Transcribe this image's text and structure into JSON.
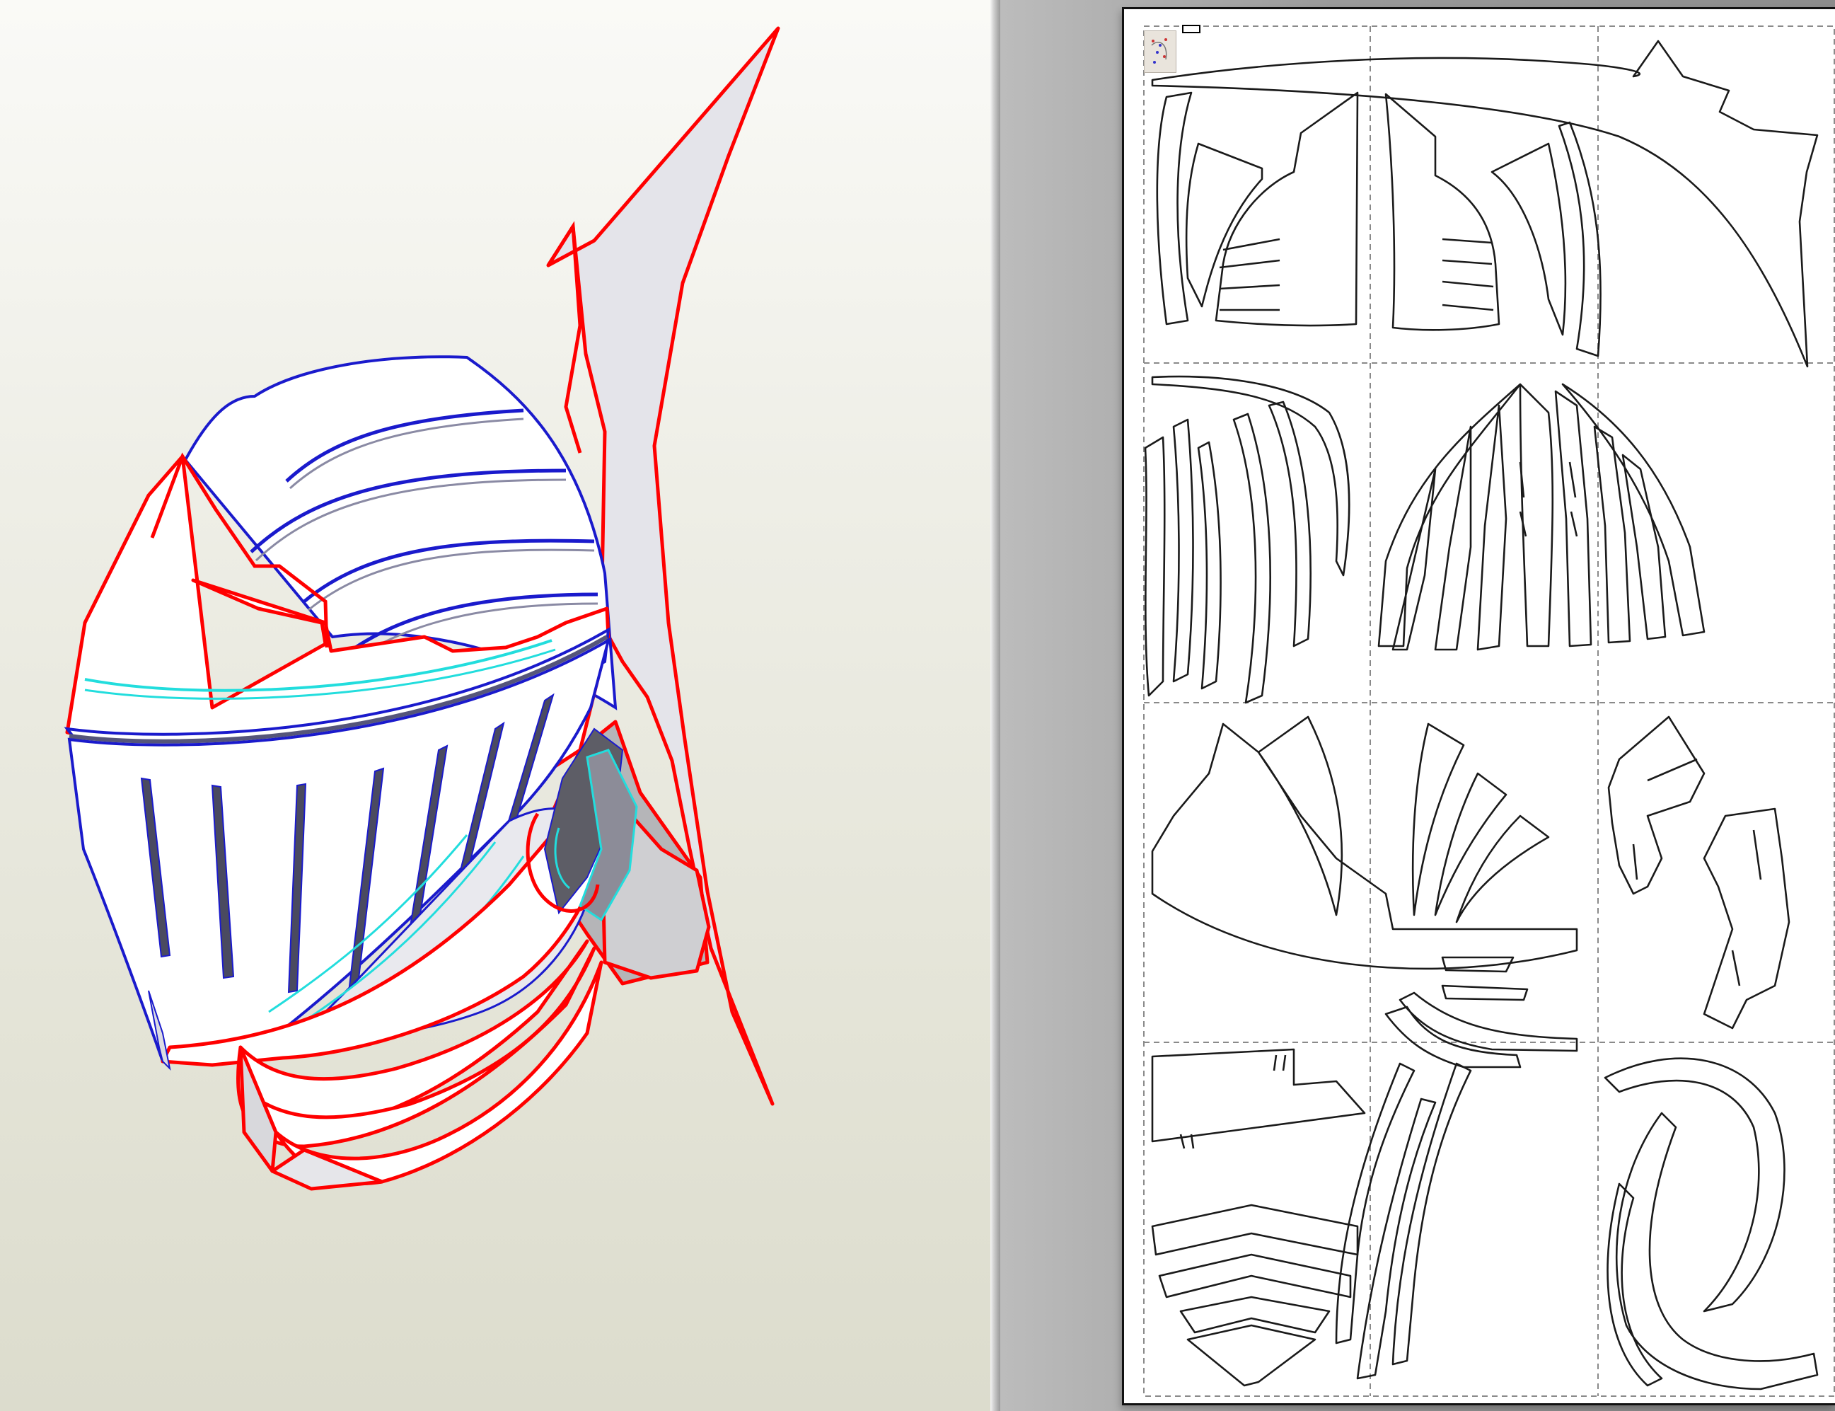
{
  "app": {
    "left_panel": "3d-view",
    "right_panel": "2d-unfold-view"
  },
  "model": {
    "subject": "knight-helmet",
    "edge_colors": {
      "cut_line": "#ff0000",
      "fold_line": "#1a1acc",
      "glue_edge": "#22dddd",
      "face": "#ffffff",
      "shade": "#e4e4ea"
    }
  },
  "sheet": {
    "grid": "3x4",
    "pieces_color": "#000000",
    "thumbnail_icon": "texture-thumbnail-icon",
    "page_label_icon": "page-label-icon"
  }
}
